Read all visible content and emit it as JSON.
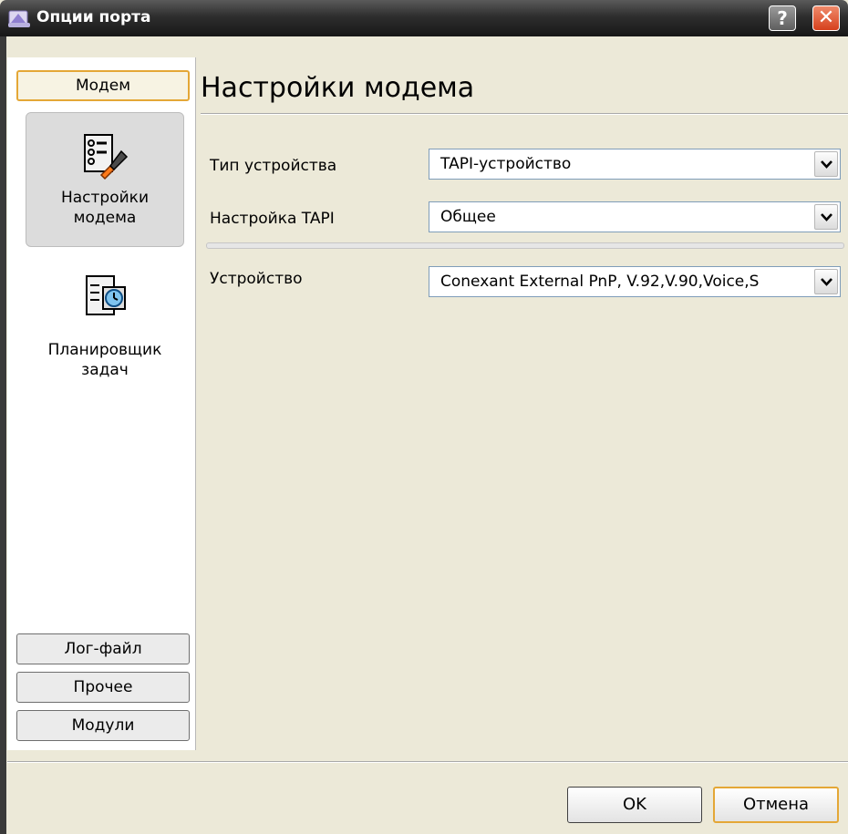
{
  "window": {
    "title": "Опции порта",
    "help_label": "?",
    "close_label": "✕"
  },
  "nav": {
    "top_button": "Модем",
    "items": [
      {
        "line1": "Настройки",
        "line2": "модема",
        "icon": "modem-settings-icon",
        "selected": true
      },
      {
        "line1": "Планировщик",
        "line2": "задач",
        "icon": "task-scheduler-icon",
        "selected": false
      }
    ],
    "bottom_buttons": [
      "Лог-файл",
      "Прочее",
      "Модули"
    ]
  },
  "content": {
    "heading": "Настройки модема",
    "fields": [
      {
        "label": "Тип устройства",
        "value": "TAPI-устройство"
      },
      {
        "label": "Настройка TAPI",
        "value": "Общее"
      },
      {
        "label": "Устройство",
        "value": "Conexant External PnP, V.92,V.90,Voice,S"
      }
    ]
  },
  "footer": {
    "ok_label": "OK",
    "cancel_label": "Отмена"
  },
  "colors": {
    "accent_border": "#e4a736",
    "title_bar": "#2e2e2e",
    "close_button": "#d6401c"
  }
}
